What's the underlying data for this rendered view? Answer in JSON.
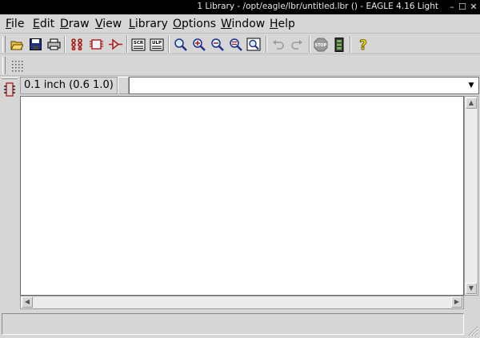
{
  "window": {
    "title": "1 Library - /opt/eagle/lbr/untitled.lbr () - EAGLE 4.16 Light",
    "minimize_glyph": "–",
    "maximize_glyph": "☐",
    "close_glyph": "✕"
  },
  "menu": {
    "items": [
      {
        "label": "File"
      },
      {
        "label": "Edit"
      },
      {
        "label": "Draw"
      },
      {
        "label": "View"
      },
      {
        "label": "Library"
      },
      {
        "label": "Options"
      },
      {
        "label": "Window"
      },
      {
        "label": "Help"
      }
    ]
  },
  "toolbar": {
    "buttons": [
      {
        "icon": "open-folder-icon"
      },
      {
        "icon": "save-icon"
      },
      {
        "icon": "print-icon"
      },
      {
        "icon": "package-icon"
      },
      {
        "icon": "symbol-icon"
      },
      {
        "icon": "device-icon"
      },
      {
        "icon": "script-icon",
        "label": "SCR"
      },
      {
        "icon": "ulp-icon",
        "label": "ULP"
      },
      {
        "icon": "zoom-fit-icon"
      },
      {
        "icon": "zoom-in-icon"
      },
      {
        "icon": "zoom-out-icon"
      },
      {
        "icon": "zoom-redraw-icon"
      },
      {
        "icon": "zoom-select-icon"
      },
      {
        "icon": "undo-icon"
      },
      {
        "icon": "redo-icon"
      },
      {
        "icon": "stop-icon",
        "label": "STOP"
      },
      {
        "icon": "go-icon"
      },
      {
        "icon": "help-icon",
        "label": "?"
      }
    ]
  },
  "toolbar2": {
    "buttons": [
      {
        "icon": "grid-icon"
      }
    ]
  },
  "left_tools": {
    "buttons": [
      {
        "icon": "component-tool-icon"
      }
    ]
  },
  "coordinates": {
    "text": "0.1 inch (0.6 1.0)"
  },
  "command_line": {
    "value": "",
    "dropdown_glyph": "▼"
  },
  "scrollbars": {
    "up": "▲",
    "down": "▼",
    "left": "◀",
    "right": "▶"
  },
  "status": {
    "text": ""
  },
  "colors": {
    "titlebar": "#000000",
    "chrome": "#d6d6d6",
    "canvas": "#ffffff",
    "accent_red": "#b01818",
    "help_yellow": "#f0e000"
  }
}
